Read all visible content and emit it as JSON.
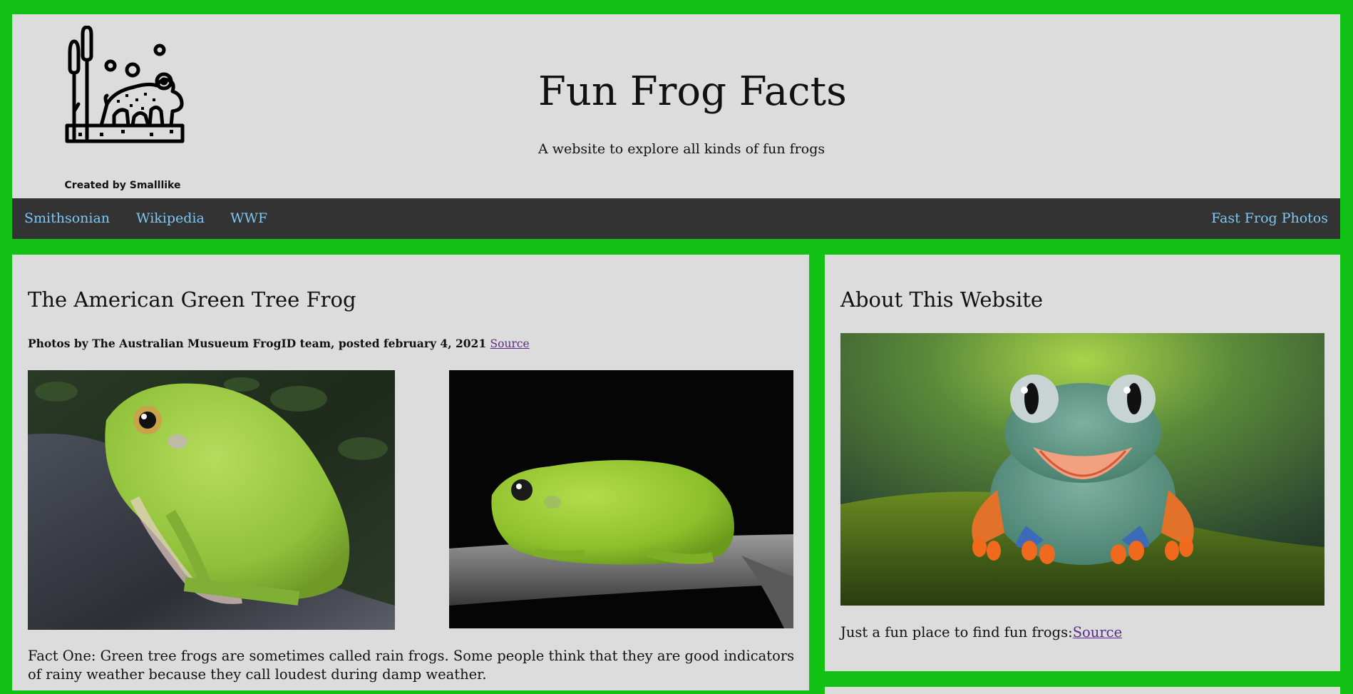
{
  "header": {
    "logo_credit": "Created by Smalllike",
    "title": "Fun Frog Facts",
    "tagline": "A website to explore all kinds of fun frogs"
  },
  "nav": {
    "left_links": [
      "Smithsonian",
      "Wikipedia",
      "WWF"
    ],
    "right_link": "Fast Frog Photos"
  },
  "article": {
    "title": "The American Green Tree Frog",
    "byline": "Photos by The Australian Musueum FrogID team, posted february 4, 2021",
    "source_link": "Source",
    "fact": "Fact One: Green tree frogs are sometimes called rain frogs. Some people think that they are good indicators of rainy weather because they call loudest during damp weather."
  },
  "about": {
    "title": "About This Website",
    "text": "Just a fun place to find fun frogs:",
    "source_link": "Source"
  },
  "colors": {
    "page_background": "#11c113",
    "panel_background": "#dcdcdc",
    "nav_background": "#333333",
    "nav_link": "#7ec8f4",
    "visited_link": "#5a2a8a"
  }
}
